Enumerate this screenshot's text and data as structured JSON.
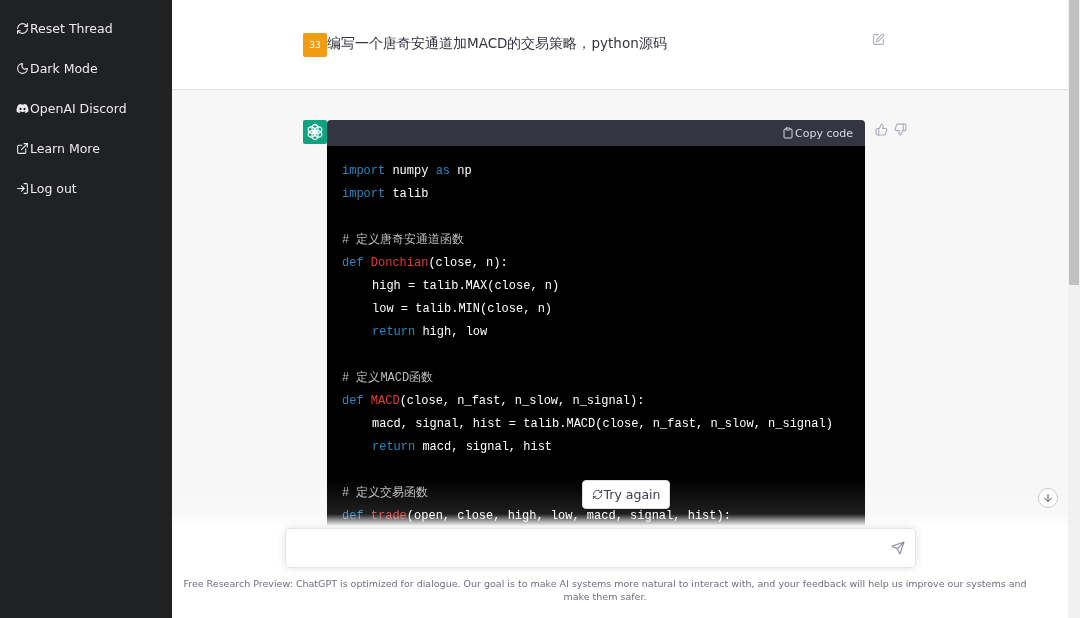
{
  "sidebar": {
    "items": [
      {
        "kind": "reset",
        "label": "Reset Thread"
      },
      {
        "kind": "theme",
        "label": "Dark Mode"
      },
      {
        "kind": "discord",
        "label": "OpenAI Discord"
      },
      {
        "kind": "external",
        "label": "Learn More"
      },
      {
        "kind": "logout",
        "label": "Log out"
      }
    ]
  },
  "user_message": {
    "avatar": "33",
    "text": "编写一个唐奇安通道加MACD的交易策略，python源码"
  },
  "assistant_message": {
    "copy_button": "Copy code",
    "code_lines": [
      {
        "kind": "code",
        "indent": false,
        "tokens": [
          {
            "kind": "kw",
            "text": "import "
          },
          {
            "kind": "plain",
            "text": "numpy "
          },
          {
            "kind": "kw",
            "text": "as "
          },
          {
            "kind": "plain",
            "text": "np"
          }
        ]
      },
      {
        "kind": "code",
        "indent": false,
        "tokens": [
          {
            "kind": "kw",
            "text": "import "
          },
          {
            "kind": "plain",
            "text": "talib"
          }
        ]
      },
      {
        "kind": "blank"
      },
      {
        "kind": "code",
        "indent": false,
        "tokens": [
          {
            "kind": "comment",
            "text": "# 定义唐奇安通道函数"
          }
        ]
      },
      {
        "kind": "code",
        "indent": false,
        "tokens": [
          {
            "kind": "kw",
            "text": "def "
          },
          {
            "kind": "fn",
            "text": "Donchian"
          },
          {
            "kind": "plain",
            "text": "(close, n):"
          }
        ]
      },
      {
        "kind": "code",
        "indent": true,
        "tokens": [
          {
            "kind": "plain",
            "text": "high = talib.MAX(close, n)"
          }
        ]
      },
      {
        "kind": "code",
        "indent": true,
        "tokens": [
          {
            "kind": "plain",
            "text": "low = talib.MIN(close, n)"
          }
        ]
      },
      {
        "kind": "code",
        "indent": true,
        "tokens": [
          {
            "kind": "kw",
            "text": "return "
          },
          {
            "kind": "plain",
            "text": "high, low"
          }
        ]
      },
      {
        "kind": "blank"
      },
      {
        "kind": "code",
        "indent": false,
        "tokens": [
          {
            "kind": "comment",
            "text": "# 定义MACD函数"
          }
        ]
      },
      {
        "kind": "code",
        "indent": false,
        "tokens": [
          {
            "kind": "kw",
            "text": "def "
          },
          {
            "kind": "fn",
            "text": "MACD"
          },
          {
            "kind": "plain",
            "text": "(close, n_fast, n_slow, n_signal):"
          }
        ]
      },
      {
        "kind": "code",
        "indent": true,
        "tokens": [
          {
            "kind": "plain",
            "text": "macd, signal, hist = talib.MACD(close, n_fast, n_slow, n_signal)"
          }
        ]
      },
      {
        "kind": "code",
        "indent": true,
        "tokens": [
          {
            "kind": "kw",
            "text": "return "
          },
          {
            "kind": "plain",
            "text": "macd, signal, hist"
          }
        ]
      },
      {
        "kind": "blank"
      },
      {
        "kind": "code",
        "indent": false,
        "tokens": [
          {
            "kind": "comment",
            "text": "# 定义交易函数"
          }
        ]
      },
      {
        "kind": "code",
        "indent": false,
        "tokens": [
          {
            "kind": "kw",
            "text": "def "
          },
          {
            "kind": "fn",
            "text": "trade"
          },
          {
            "kind": "plain",
            "text": "(open, close, high, low, macd, signal, hist):"
          }
        ]
      }
    ]
  },
  "try_again_button": "Try again",
  "footer": "Free Research Preview: ChatGPT is optimized for dialogue. Our goal is to make AI systems more natural to interact with, and your feedback will help us improve our systems and make them safer."
}
